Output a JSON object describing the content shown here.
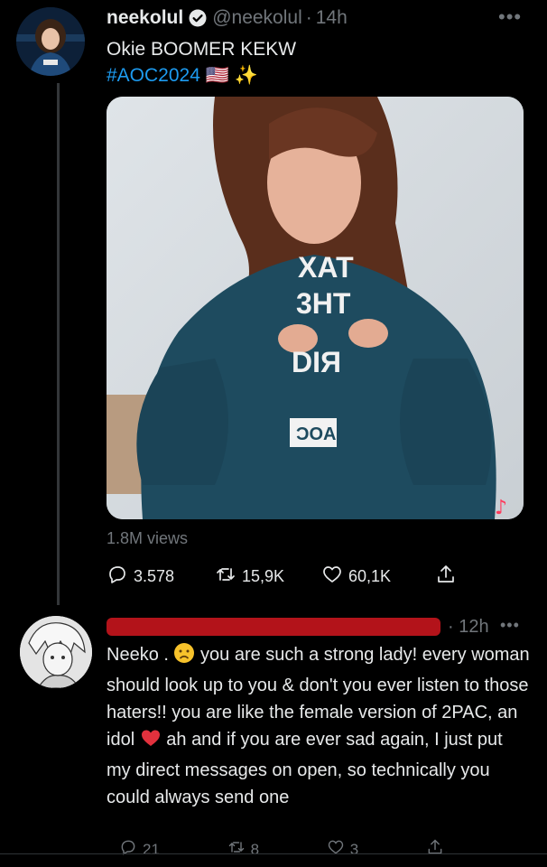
{
  "tweet": {
    "display_name": "neekolul",
    "handle": "@neekolul",
    "separator": "·",
    "time": "14h",
    "line1": "Okie BOOMER KEKW",
    "hashtag": "#AOC2024",
    "hashtag_emoji": "🇺🇸 ✨",
    "views": "1.8M views",
    "replies": "3.578",
    "retweets": "15,9K",
    "likes": "60,1K"
  },
  "media": {
    "shirt_text": [
      "XAT",
      "3HT",
      "DIЯ"
    ],
    "shirt_badge": "ƆOA"
  },
  "reply": {
    "time": "· 12h",
    "text_before_emoji1": "Neeko . ",
    "text_after_emoji1": " you are such a strong lady! every woman should look up to you & don't you ever listen to those haters!! you are like the female version of 2PAC, an idol ",
    "text_after_emoji2": " ah and if you are ever sad again, I just put my direct messages on open, so technically you could always send one",
    "replies": "21",
    "retweets": "8",
    "likes": "3"
  },
  "icons": {
    "more": "more-dots-icon",
    "reply": "reply-icon",
    "retweet": "retweet-icon",
    "like": "like-icon",
    "share": "share-icon"
  },
  "colors": {
    "background": "#000000",
    "text": "#e7e9ea",
    "muted": "#71767b",
    "link": "#1d9bf0",
    "redaction": "#b3131a"
  }
}
